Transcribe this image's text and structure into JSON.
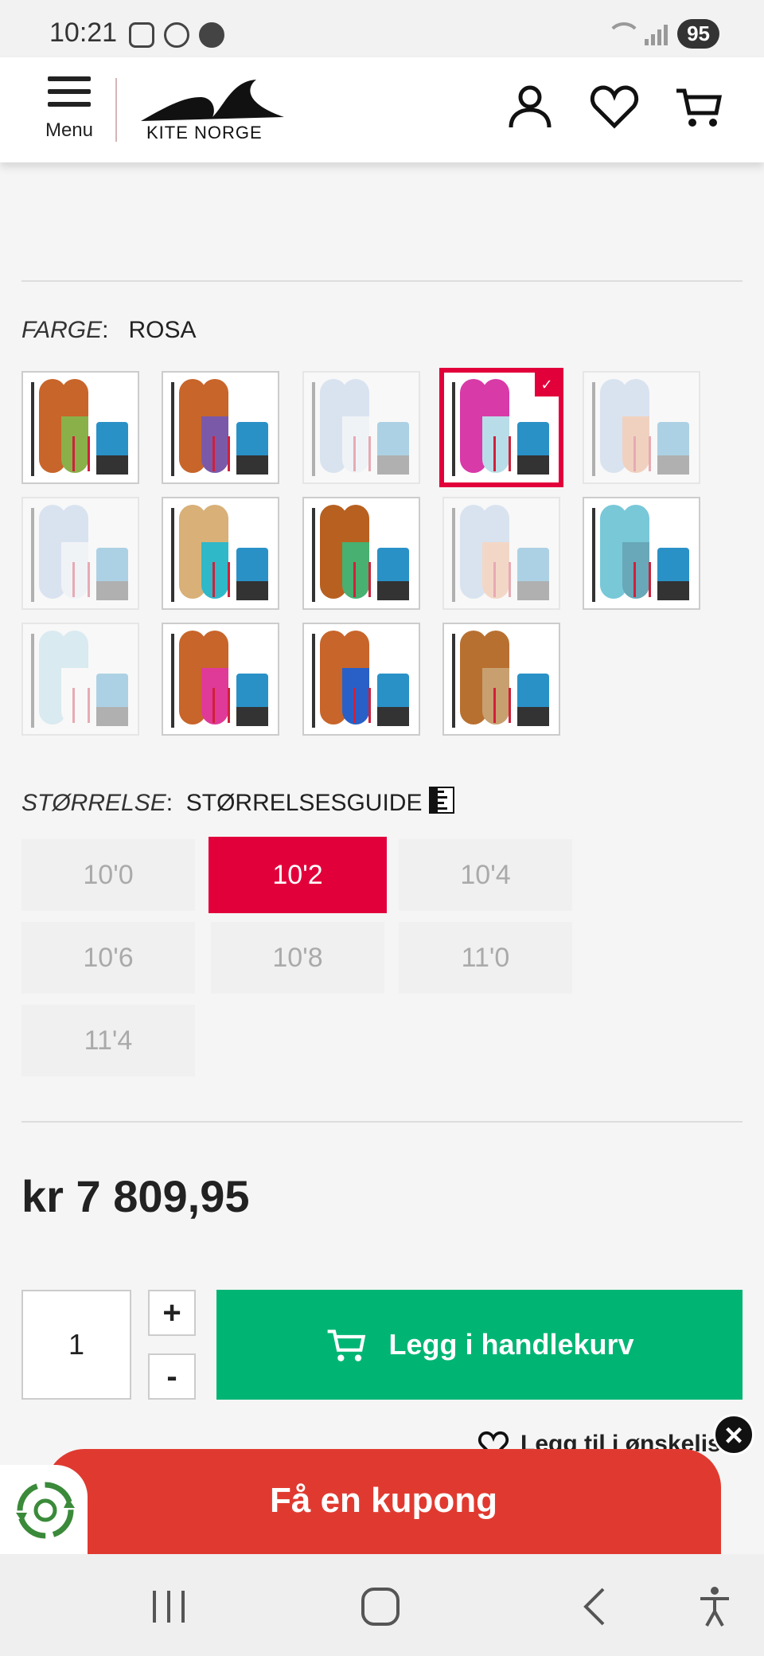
{
  "status_bar": {
    "time": "10:21",
    "battery": "95",
    "icons_left": [
      "screenshot-icon",
      "alarm-icon",
      "messenger-icon"
    ],
    "icons_right": [
      "wifi-icon",
      "signal-icon",
      "battery-icon"
    ]
  },
  "header": {
    "menu_label": "Menu",
    "logo_text": "KITE NORGE",
    "icons": [
      "account-icon",
      "wishlist-heart-icon",
      "cart-icon"
    ]
  },
  "color_section": {
    "label": "FARGE",
    "value": "ROSA",
    "selected_index": 3,
    "swatches": [
      {
        "board": "#c8652a",
        "accent": "#8ab04a",
        "available": true
      },
      {
        "board": "#c8652a",
        "accent": "#7a5aa8",
        "available": true
      },
      {
        "board": "#a8c4e8",
        "accent": "#e8f0fa",
        "available": false
      },
      {
        "board": "#d83aa8",
        "accent": "#b9dde8",
        "available": true
      },
      {
        "board": "#a8c4e8",
        "accent": "#e89060",
        "available": false
      },
      {
        "board": "#a8c4e8",
        "accent": "#e8f0fa",
        "available": false
      },
      {
        "board": "#d8b078",
        "accent": "#2fb8c8",
        "available": true
      },
      {
        "board": "#b86020",
        "accent": "#48b070",
        "available": true
      },
      {
        "board": "#a8c4e8",
        "accent": "#f0a070",
        "available": false
      },
      {
        "board": "#78c8d8",
        "accent": "#68a8b8",
        "available": true
      },
      {
        "board": "#a8d8e8",
        "accent": "#ffffff",
        "available": false
      },
      {
        "board": "#c8652a",
        "accent": "#e03a98",
        "available": true
      },
      {
        "board": "#c8652a",
        "accent": "#2860c8",
        "available": true
      },
      {
        "board": "#b87030",
        "accent": "#c8a070",
        "available": true
      }
    ]
  },
  "size_section": {
    "label": "STØRRELSE",
    "guide_label": "STØRRELSESGUIDE",
    "selected": "10'2",
    "sizes": [
      "10'0",
      "10'2",
      "10'4",
      "10'6",
      "10'8",
      "11'0",
      "11'4"
    ]
  },
  "price": "kr 7 809,95",
  "purchase": {
    "quantity": "1",
    "plus_label": "+",
    "minus_label": "-",
    "add_to_cart_label": "Legg i handlekurv",
    "wishlist_label": "Legg til i ønskelis"
  },
  "coupon": {
    "label": "Få en kupong",
    "close_label": "×"
  },
  "colors": {
    "accent": "#e2003b",
    "cart_button": "#00b574",
    "coupon": "#e03a30"
  }
}
